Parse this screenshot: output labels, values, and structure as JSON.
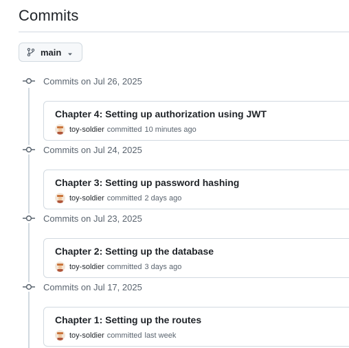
{
  "page": {
    "title": "Commits"
  },
  "branch": {
    "name": "main"
  },
  "commit_groups": [
    {
      "date_label": "Commits on Jul 26, 2025",
      "commits": [
        {
          "title": "Chapter 4: Setting up authorization using JWT",
          "author": "toy-soldier",
          "action": "committed",
          "time": "10 minutes ago"
        }
      ]
    },
    {
      "date_label": "Commits on Jul 24, 2025",
      "commits": [
        {
          "title": "Chapter 3: Setting up password hashing",
          "author": "toy-soldier",
          "action": "committed",
          "time": "2 days ago"
        }
      ]
    },
    {
      "date_label": "Commits on Jul 23, 2025",
      "commits": [
        {
          "title": "Chapter 2: Setting up the database",
          "author": "toy-soldier",
          "action": "committed",
          "time": "3 days ago"
        }
      ]
    },
    {
      "date_label": "Commits on Jul 17, 2025",
      "commits": [
        {
          "title": "Chapter 1: Setting up the routes",
          "author": "toy-soldier",
          "action": "committed",
          "time": "last week"
        }
      ]
    }
  ],
  "icons": {
    "branch": "git-branch-icon",
    "caret": "triangle-down-icon",
    "commit_node": "git-commit-icon",
    "avatar": "user-avatar"
  },
  "colors": {
    "text_primary": "#1f2328",
    "text_muted": "#59636e",
    "border": "#d1d9e0",
    "button_bg": "#f6f8fa"
  }
}
